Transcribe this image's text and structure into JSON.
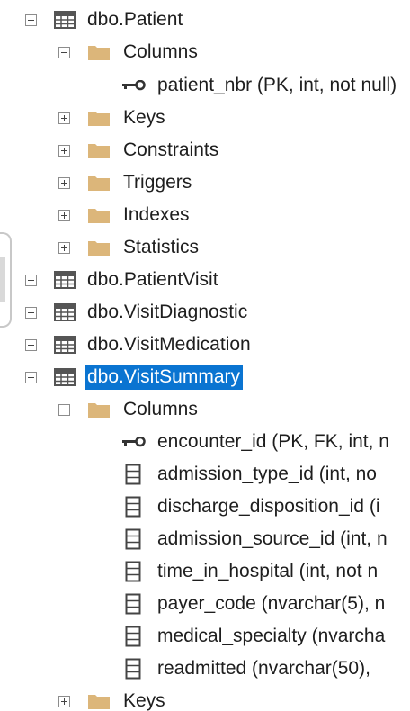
{
  "tree": {
    "patient_table": "dbo.Patient",
    "patient_columns_folder": "Columns",
    "patient_column_1": "patient_nbr (PK, int, not null)",
    "patient_keys_folder": "Keys",
    "patient_constraints_folder": "Constraints",
    "patient_triggers_folder": "Triggers",
    "patient_indexes_folder": "Indexes",
    "patient_statistics_folder": "Statistics",
    "patientvisit_table": "dbo.PatientVisit",
    "visitdiagnostic_table": "dbo.VisitDiagnostic",
    "visitmedication_table": "dbo.VisitMedication",
    "visitsummary_table": "dbo.VisitSummary",
    "visitsummary_columns_folder": "Columns",
    "vs_columns": [
      "encounter_id (PK, FK, int, n",
      "admission_type_id (int, no",
      "discharge_disposition_id (i",
      "admission_source_id (int, n",
      "time_in_hospital (int, not n",
      "payer_code (nvarchar(5), n",
      "medical_specialty (nvarcha",
      "readmitted (nvarchar(50), "
    ],
    "visitsummary_keys_folder": "Keys"
  },
  "colors": {
    "selection": "#0a74d1",
    "folder": "#dcb67a"
  }
}
